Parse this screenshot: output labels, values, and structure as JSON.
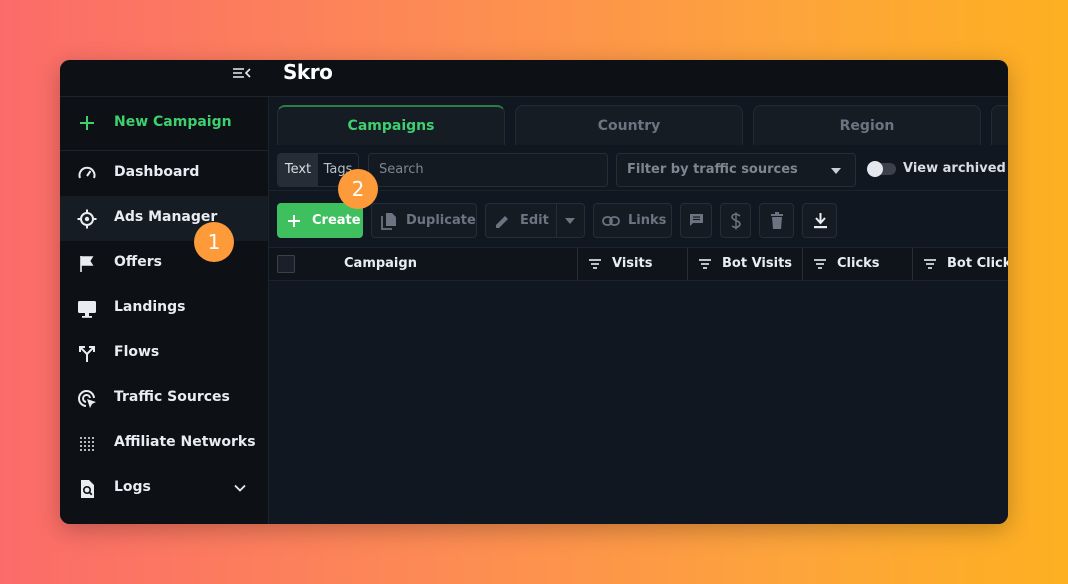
{
  "app": {
    "logo": "Skro"
  },
  "sidebar": {
    "new_campaign": "New Campaign",
    "items": [
      {
        "label": "Dashboard",
        "icon": "speedometer-icon"
      },
      {
        "label": "Ads Manager",
        "icon": "crosshair-icon",
        "active": true
      },
      {
        "label": "Offers",
        "icon": "flag-icon"
      },
      {
        "label": "Landings",
        "icon": "monitor-icon"
      },
      {
        "label": "Flows",
        "icon": "split-arrow-icon"
      },
      {
        "label": "Traffic Sources",
        "icon": "target-cursor-icon"
      },
      {
        "label": "Affiliate Networks",
        "icon": "dots-grid-icon"
      },
      {
        "label": "Logs",
        "icon": "document-search-icon"
      }
    ]
  },
  "tabs": [
    "Campaigns",
    "Country",
    "Region"
  ],
  "filters": {
    "seg_text": "Text",
    "seg_tags": "Tags",
    "search_placeholder": "Search",
    "traffic_filter": "Filter by traffic sources",
    "view_archived": "View archived"
  },
  "toolbar": {
    "create": "Create",
    "duplicate": "Duplicate",
    "edit": "Edit",
    "links": "Links"
  },
  "table": {
    "columns": [
      "Campaign",
      "Visits",
      "Bot Visits",
      "Clicks",
      "Bot Clicks"
    ]
  },
  "annotations": [
    "1",
    "2"
  ],
  "colors": {
    "accent_green": "#3ecf6e",
    "create_green": "#3ec05e",
    "badge_orange": "#fd9a3a"
  }
}
